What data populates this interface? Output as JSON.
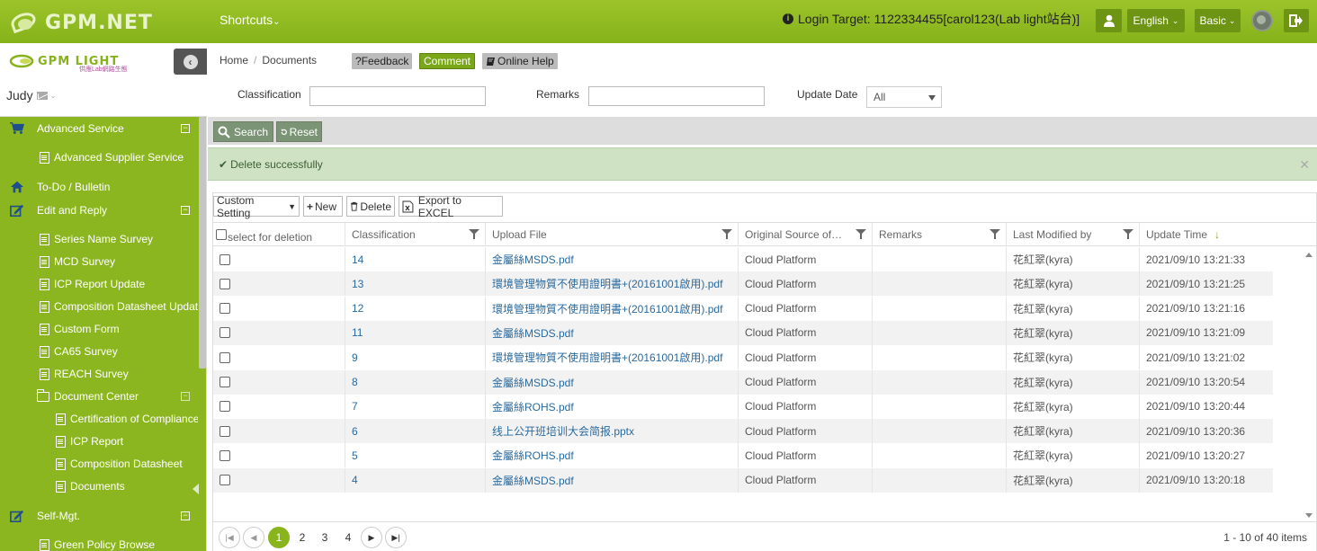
{
  "topbar": {
    "logo_text": "GPM.NET",
    "shortcuts": "Shortcuts",
    "login_target": "Login Target: 1122334455[carol123(Lab light站台)]",
    "language": "English",
    "plan": "Basic"
  },
  "sidebar": {
    "brand": "GPM LIGHT",
    "brand_sub": "供應Lab網路生態",
    "user": "Judy",
    "items": [
      {
        "label": "Advanced Service",
        "icon": "cart-icon",
        "level": 0,
        "toggle": "−"
      },
      {
        "label": "Advanced Supplier Service",
        "icon": "document-icon",
        "level": 1
      },
      {
        "label": "To-Do / Bulletin",
        "icon": "home-icon",
        "level": 0
      },
      {
        "label": "Edit and Reply",
        "icon": "edit-icon",
        "level": 0,
        "toggle": "−"
      },
      {
        "label": "Series Name Survey",
        "icon": "document-icon",
        "level": 1
      },
      {
        "label": "MCD Survey",
        "icon": "document-icon",
        "level": 1
      },
      {
        "label": "ICP Report Update",
        "icon": "document-icon",
        "level": 1
      },
      {
        "label": "Composition Datasheet Update",
        "icon": "document-icon",
        "level": 1
      },
      {
        "label": "Custom Form",
        "icon": "document-icon",
        "level": 1
      },
      {
        "label": "CA65 Survey",
        "icon": "document-icon",
        "level": 1
      },
      {
        "label": "REACH Survey",
        "icon": "document-icon",
        "level": 1
      },
      {
        "label": "Document Center",
        "icon": "folder-icon",
        "level": 1,
        "toggle": "−"
      },
      {
        "label": "Certification of Compliance",
        "icon": "document-icon",
        "level": 2
      },
      {
        "label": "ICP Report",
        "icon": "document-icon",
        "level": 2
      },
      {
        "label": "Composition Datasheet",
        "icon": "document-icon",
        "level": 2
      },
      {
        "label": "Documents",
        "icon": "document-icon",
        "level": 2
      },
      {
        "label": "Self-Mgt.",
        "icon": "edit-icon",
        "level": 0,
        "toggle": "−"
      },
      {
        "label": "Green Policy Browse",
        "icon": "document-icon",
        "level": 1
      }
    ]
  },
  "main": {
    "breadcrumb": {
      "home": "Home",
      "sep": "/",
      "current": "Documents"
    },
    "tags": {
      "feedback": "?Feedback",
      "comment": "Comment",
      "help": "Online Help"
    },
    "filters": {
      "classification_label": "Classification",
      "remarks_label": "Remarks",
      "update_date_label": "Update Date",
      "update_date_value": "All"
    },
    "actions": {
      "search": "Search",
      "reset": "Reset"
    },
    "alert": "Delete successfully",
    "toolbar": {
      "custom": "Custom Setting",
      "new": "New",
      "delete": "Delete",
      "excel": "Export to EXCEL"
    },
    "columns": [
      "select for deletion",
      "Classification",
      "Upload File",
      "Original Source of…",
      "Remarks",
      "Last Modified by",
      "Update Time"
    ],
    "rows": [
      {
        "cls": "14",
        "file": "金屬絲MSDS.pdf",
        "source": "Cloud Platform",
        "remarks": "",
        "by": "花紅翠(kyra)",
        "time": "2021/09/10 13:21:33"
      },
      {
        "cls": "13",
        "file": "環境管理物質不使用證明書+(20161001啟用).pdf",
        "source": "Cloud Platform",
        "remarks": "",
        "by": "花紅翠(kyra)",
        "time": "2021/09/10 13:21:25"
      },
      {
        "cls": "12",
        "file": "環境管理物質不使用證明書+(20161001啟用).pdf",
        "source": "Cloud Platform",
        "remarks": "",
        "by": "花紅翠(kyra)",
        "time": "2021/09/10 13:21:16"
      },
      {
        "cls": "11",
        "file": "金屬絲MSDS.pdf",
        "source": "Cloud Platform",
        "remarks": "",
        "by": "花紅翠(kyra)",
        "time": "2021/09/10 13:21:09"
      },
      {
        "cls": "9",
        "file": "環境管理物質不使用證明書+(20161001啟用).pdf",
        "source": "Cloud Platform",
        "remarks": "",
        "by": "花紅翠(kyra)",
        "time": "2021/09/10 13:21:02"
      },
      {
        "cls": "8",
        "file": "金屬絲MSDS.pdf",
        "source": "Cloud Platform",
        "remarks": "",
        "by": "花紅翠(kyra)",
        "time": "2021/09/10 13:20:54"
      },
      {
        "cls": "7",
        "file": "金屬絲ROHS.pdf",
        "source": "Cloud Platform",
        "remarks": "",
        "by": "花紅翠(kyra)",
        "time": "2021/09/10 13:20:44"
      },
      {
        "cls": "6",
        "file": "线上公开班培训大会简报.pptx",
        "source": "Cloud Platform",
        "remarks": "",
        "by": "花紅翠(kyra)",
        "time": "2021/09/10 13:20:36"
      },
      {
        "cls": "5",
        "file": "金屬絲ROHS.pdf",
        "source": "Cloud Platform",
        "remarks": "",
        "by": "花紅翠(kyra)",
        "time": "2021/09/10 13:20:27"
      },
      {
        "cls": "4",
        "file": "金屬絲MSDS.pdf",
        "source": "Cloud Platform",
        "remarks": "",
        "by": "花紅翠(kyra)",
        "time": "2021/09/10 13:20:18"
      }
    ],
    "pager": {
      "pages": [
        "1",
        "2",
        "3",
        "4"
      ],
      "active": "1",
      "info": "1 - 10 of 40 items"
    }
  },
  "colors": {
    "accent": "#8cb61f",
    "link": "#2a6a9e",
    "alert_bg": "#cfe3c4"
  }
}
